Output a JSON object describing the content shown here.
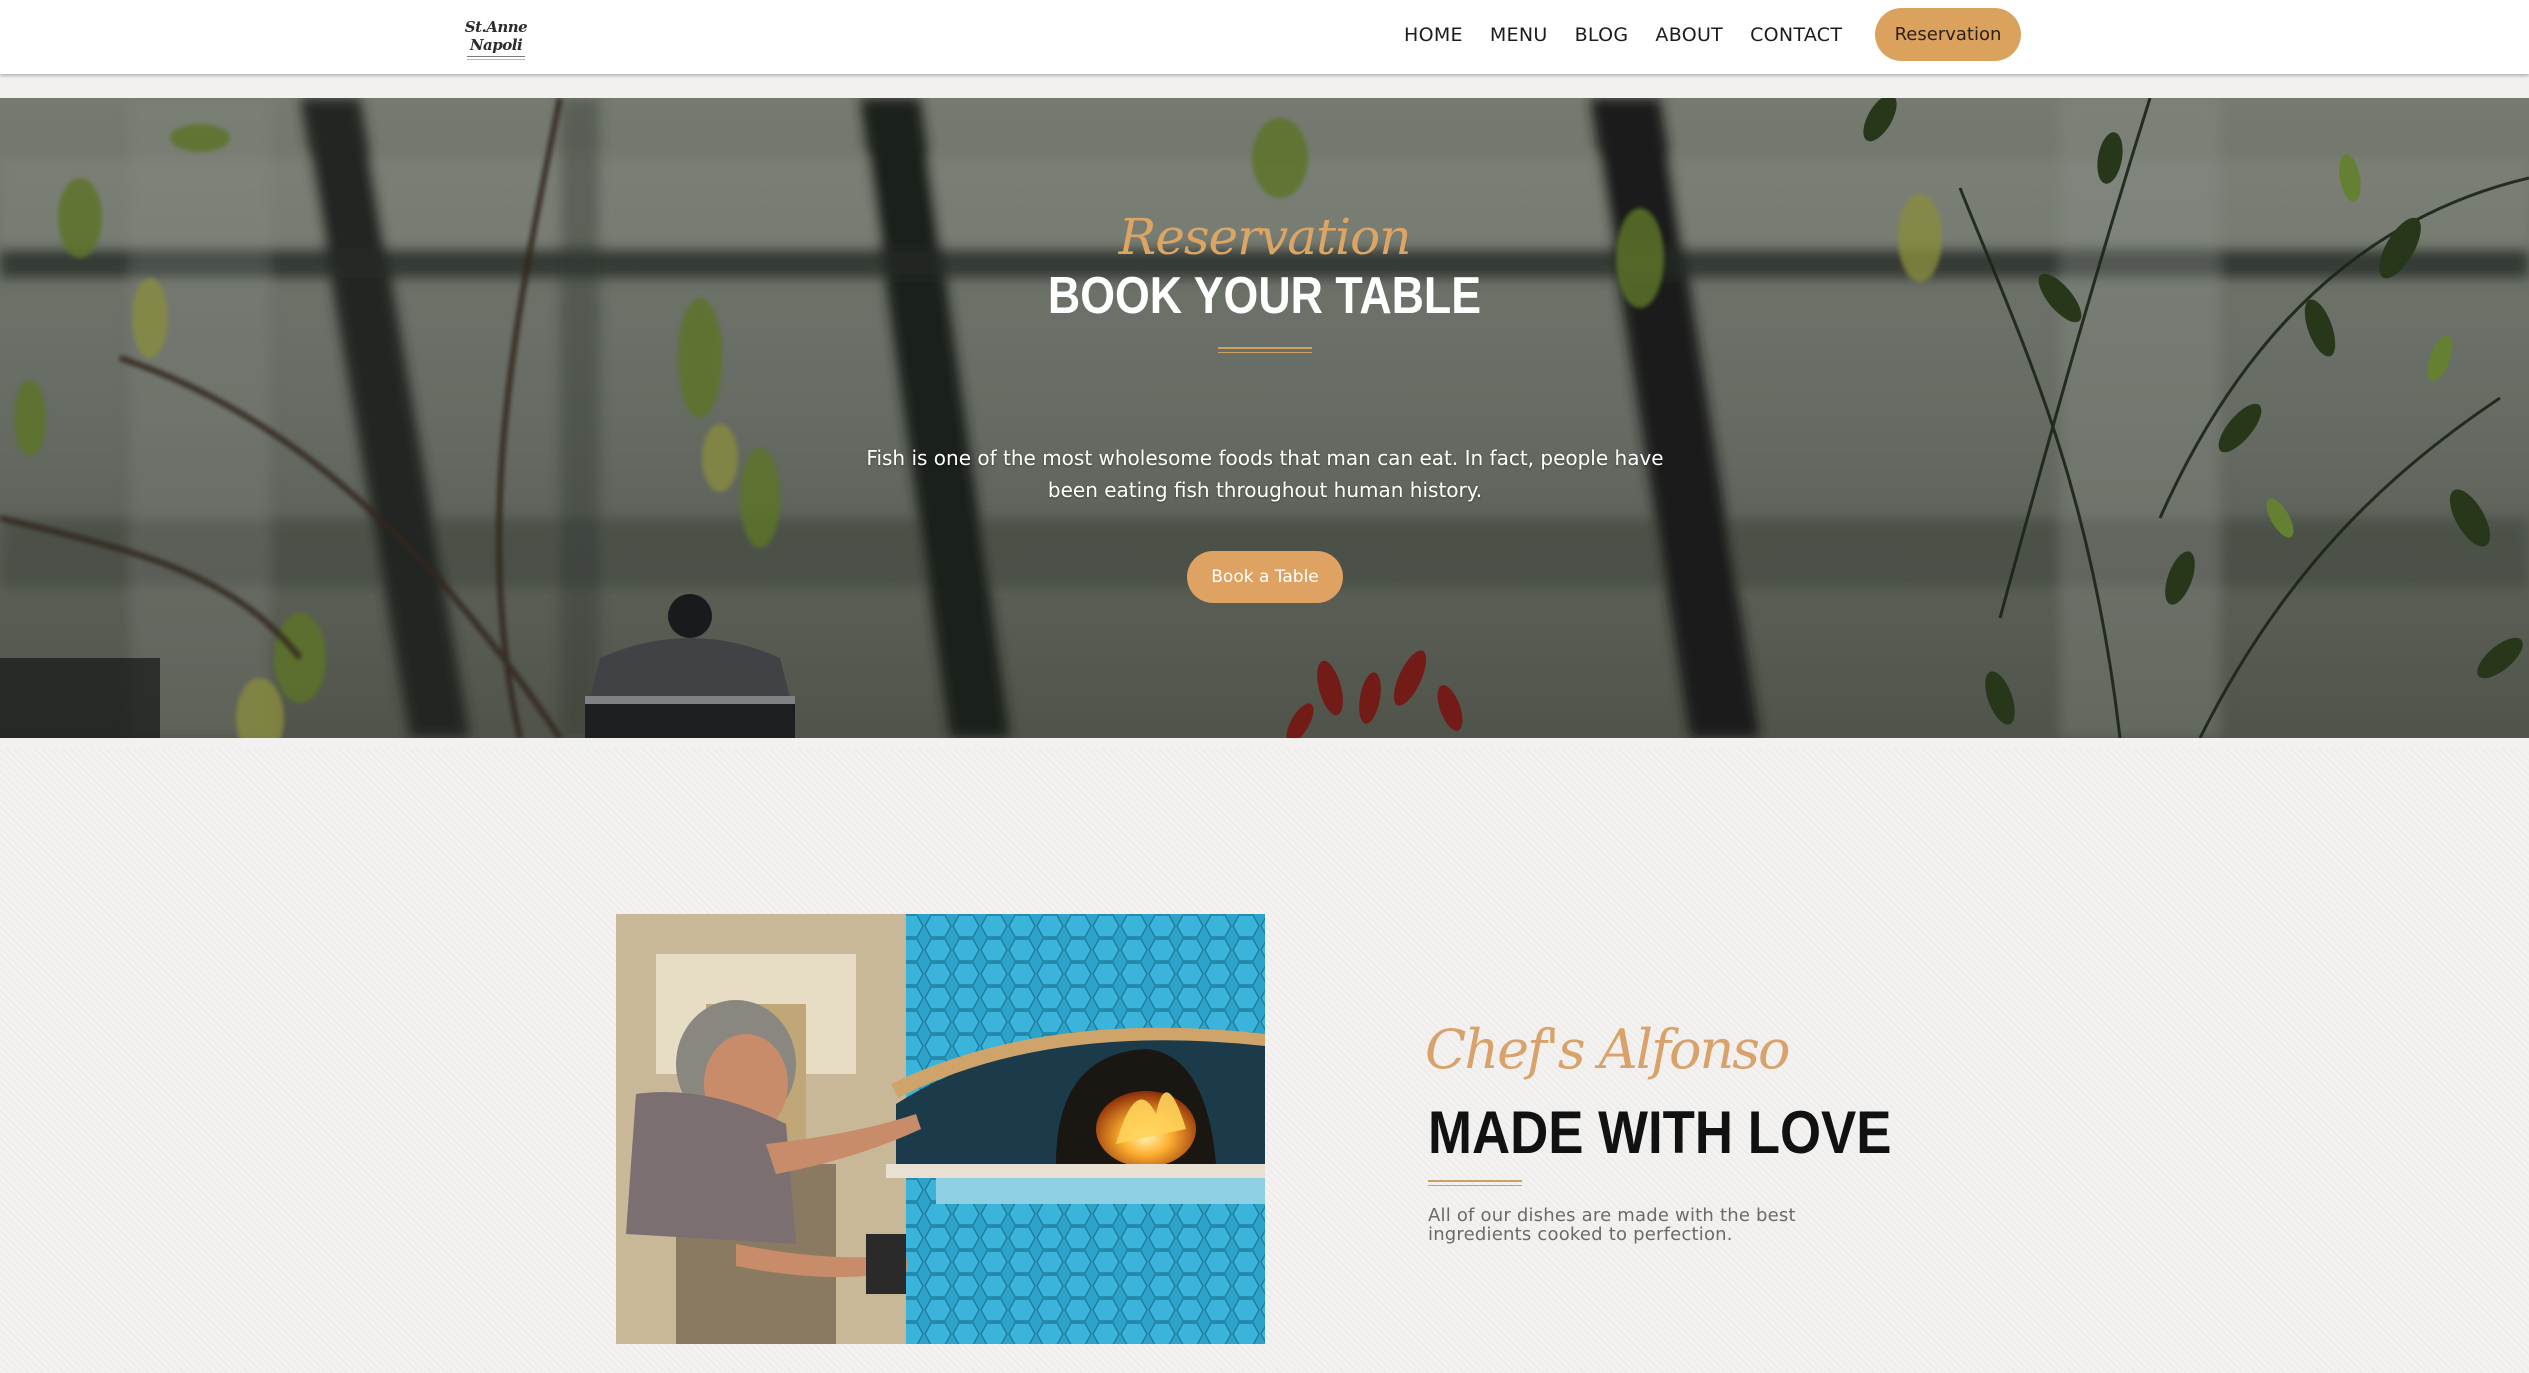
{
  "header": {
    "logo_text": "St.Anne Napoli",
    "nav": [
      "HOME",
      "MENU",
      "BLOG",
      "ABOUT",
      "CONTACT"
    ],
    "reservation_label": "Reservation",
    "accent_color": "#dba25e"
  },
  "hero": {
    "script_title": "Reservation",
    "title": "BOOK YOUR TABLE",
    "description": "Fish is one of the most wholesome foods that man can eat. In fact, people have been eating fish throughout human history.",
    "button_label": "Book a Table",
    "button_color": "#dea262"
  },
  "chef": {
    "script_title": "Chef's Alfonso",
    "title": "MADE WITH LOVE",
    "description": "All of our dishes are made with the best ingredients cooked to perfection."
  }
}
